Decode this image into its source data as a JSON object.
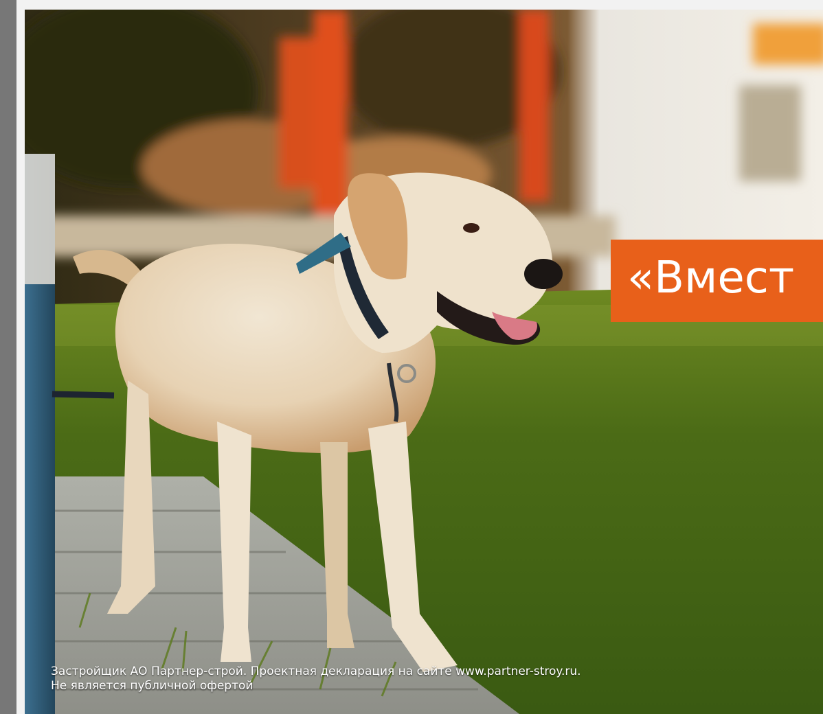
{
  "banner": {
    "text": "«Вмест",
    "color": "#e8601a"
  },
  "disclaimer": {
    "line1": "Застройщик АО Партнер-строй. Проектная декларация на сайте www.partner-stroy.ru.",
    "line2": "Не является публичной офертой"
  }
}
